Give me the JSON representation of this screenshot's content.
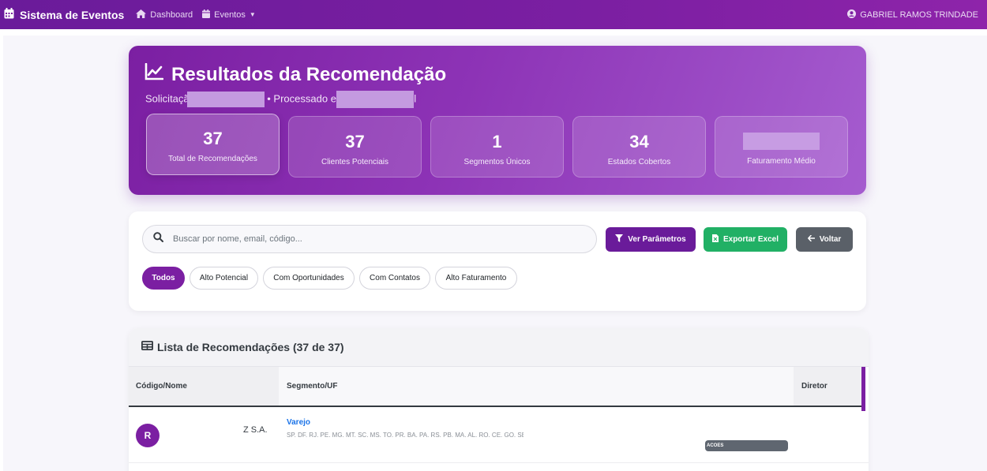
{
  "navbar": {
    "brand": "Sistema de Eventos",
    "links": [
      {
        "label": "Dashboard",
        "icon": "home-icon"
      },
      {
        "label": "Eventos",
        "icon": "calendar-icon",
        "dropdown": true
      }
    ],
    "user": "GABRIEL RAMOS TRINDADE"
  },
  "hero": {
    "title": "Resultados da Recomendação",
    "subtitle_prefix": "Solicitaçã",
    "subtitle_middle": "• Processado er",
    "subtitle_suffix": "l",
    "stats": [
      {
        "value": "37",
        "label": "Total de Recomendações",
        "active": true
      },
      {
        "value": "37",
        "label": "Clientes Potenciais"
      },
      {
        "value": "1",
        "label": "Segmentos Únicos"
      },
      {
        "value": "34",
        "label": "Estados Cobertos"
      },
      {
        "value": "",
        "label": "Faturamento Médio",
        "redacted": true
      }
    ]
  },
  "filters": {
    "search_placeholder": "Buscar por nome, email, código...",
    "buttons": {
      "params": "Ver Parâmetros",
      "excel": "Exportar Excel",
      "back": "Voltar"
    },
    "pills": [
      "Todos",
      "Alto Potencial",
      "Com Oportunidades",
      "Com Contatos",
      "Alto Faturamento"
    ],
    "active_pill": "Todos"
  },
  "list": {
    "title": "Lista de Recomendações (37 de 37)",
    "columns": [
      "Código/Nome",
      "Segmento/UF",
      "Diretor"
    ],
    "rows": [
      {
        "avatar": "R",
        "company": "Z S.A.",
        "segment": "Varejo",
        "ufs": "SP, DF, RJ, PE, MG, MT, SC, MS, TO, PR, BA, PA, RS, PB, MA, AL, RO, CE, GO, SE",
        "action": "ACOES"
      }
    ]
  },
  "colors": {
    "primary": "#7b1fa2",
    "navbar": "#6a1b9a",
    "success": "#21b065",
    "secondary": "#5a6068",
    "link": "#1a73e8"
  }
}
